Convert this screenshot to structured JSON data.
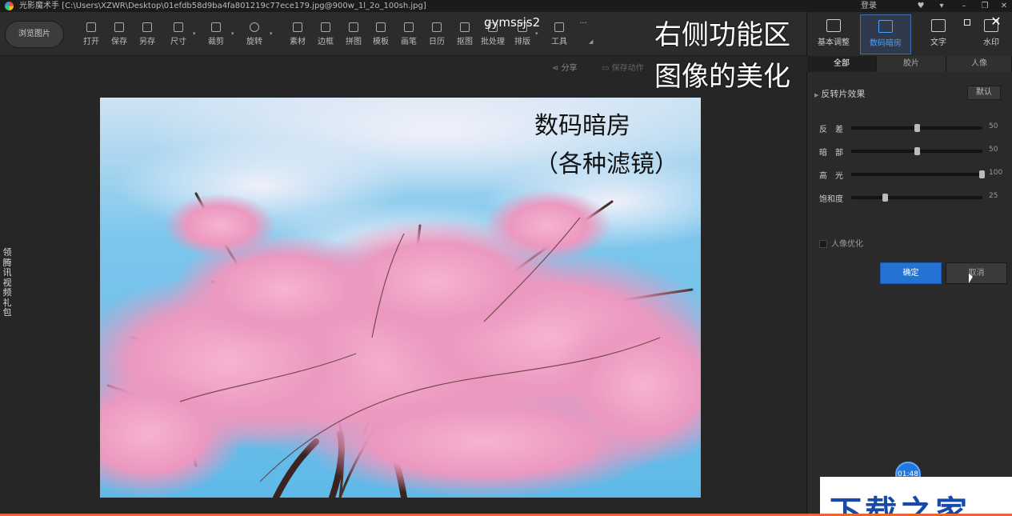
{
  "window": {
    "title": "光影魔术手 [C:\\Users\\XZWR\\Desktop\\01efdb58d9ba4fa801219c77ece179.jpg@900w_1l_2o_100sh.jpg]",
    "login": "登录"
  },
  "toolbar": {
    "browse": "浏览图片",
    "tools": [
      {
        "label": "打开",
        "icon": "open-icon"
      },
      {
        "label": "保存",
        "icon": "save-icon"
      },
      {
        "label": "另存",
        "icon": "save-as-icon"
      },
      {
        "label": "尺寸",
        "icon": "resize-icon"
      },
      {
        "label": "裁剪",
        "icon": "crop-icon"
      },
      {
        "label": "旋转",
        "icon": "rotate-icon"
      },
      {
        "label": "素材",
        "icon": "material-icon"
      },
      {
        "label": "边框",
        "icon": "border-icon"
      },
      {
        "label": "拼图",
        "icon": "collage-icon"
      },
      {
        "label": "模板",
        "icon": "template-icon"
      },
      {
        "label": "画笔",
        "icon": "brush-icon"
      },
      {
        "label": "日历",
        "icon": "calendar-icon"
      },
      {
        "label": "抠图",
        "icon": "cutout-icon"
      },
      {
        "label": "批处理",
        "icon": "batch-icon"
      },
      {
        "label": "排版",
        "icon": "layout-icon"
      },
      {
        "label": "工具",
        "icon": "tools-icon"
      }
    ],
    "more": "···"
  },
  "overlay": {
    "user": "gymssjs2",
    "title_line1": "右侧功能区",
    "title_line2": "图像的美化",
    "photo_caption_line1": "数码暗房",
    "photo_caption_line2": "（各种滤镜）",
    "side_text": "领 腾 讯 视 频 礼 包"
  },
  "subbar": {
    "share": "分享",
    "save_action": "保存动作"
  },
  "right_panel": {
    "tabs": [
      {
        "label": "基本调整",
        "icon": "basic-adjust-icon",
        "active": false
      },
      {
        "label": "数码暗房",
        "icon": "darkroom-icon",
        "active": true
      },
      {
        "label": "文字",
        "icon": "text-icon",
        "active": false
      },
      {
        "label": "水印",
        "icon": "watermark-icon",
        "active": false
      }
    ],
    "subtabs": [
      {
        "label": "全部",
        "active": true
      },
      {
        "label": "胶片",
        "active": false
      },
      {
        "label": "人像",
        "active": false
      }
    ],
    "effect_title": "反转片效果",
    "default_button": "默认",
    "sliders": [
      {
        "label": "反　差",
        "value": "50",
        "fraction": 0.5
      },
      {
        "label": "暗　部",
        "value": "50",
        "fraction": 0.5
      },
      {
        "label": "高　光",
        "value": "100",
        "fraction": 1.0
      },
      {
        "label": "饱和度",
        "value": "25",
        "fraction": 0.25
      }
    ],
    "portrait_option": "人像优化",
    "confirm": "确定",
    "cancel": "取消"
  },
  "timer": "01:48",
  "ad_text": "下载之家",
  "colors": {
    "accent": "#2473d4",
    "active_tab": "#4aa3ff",
    "sky": "#5fb9e8",
    "blossom": "#f4a7c9"
  }
}
